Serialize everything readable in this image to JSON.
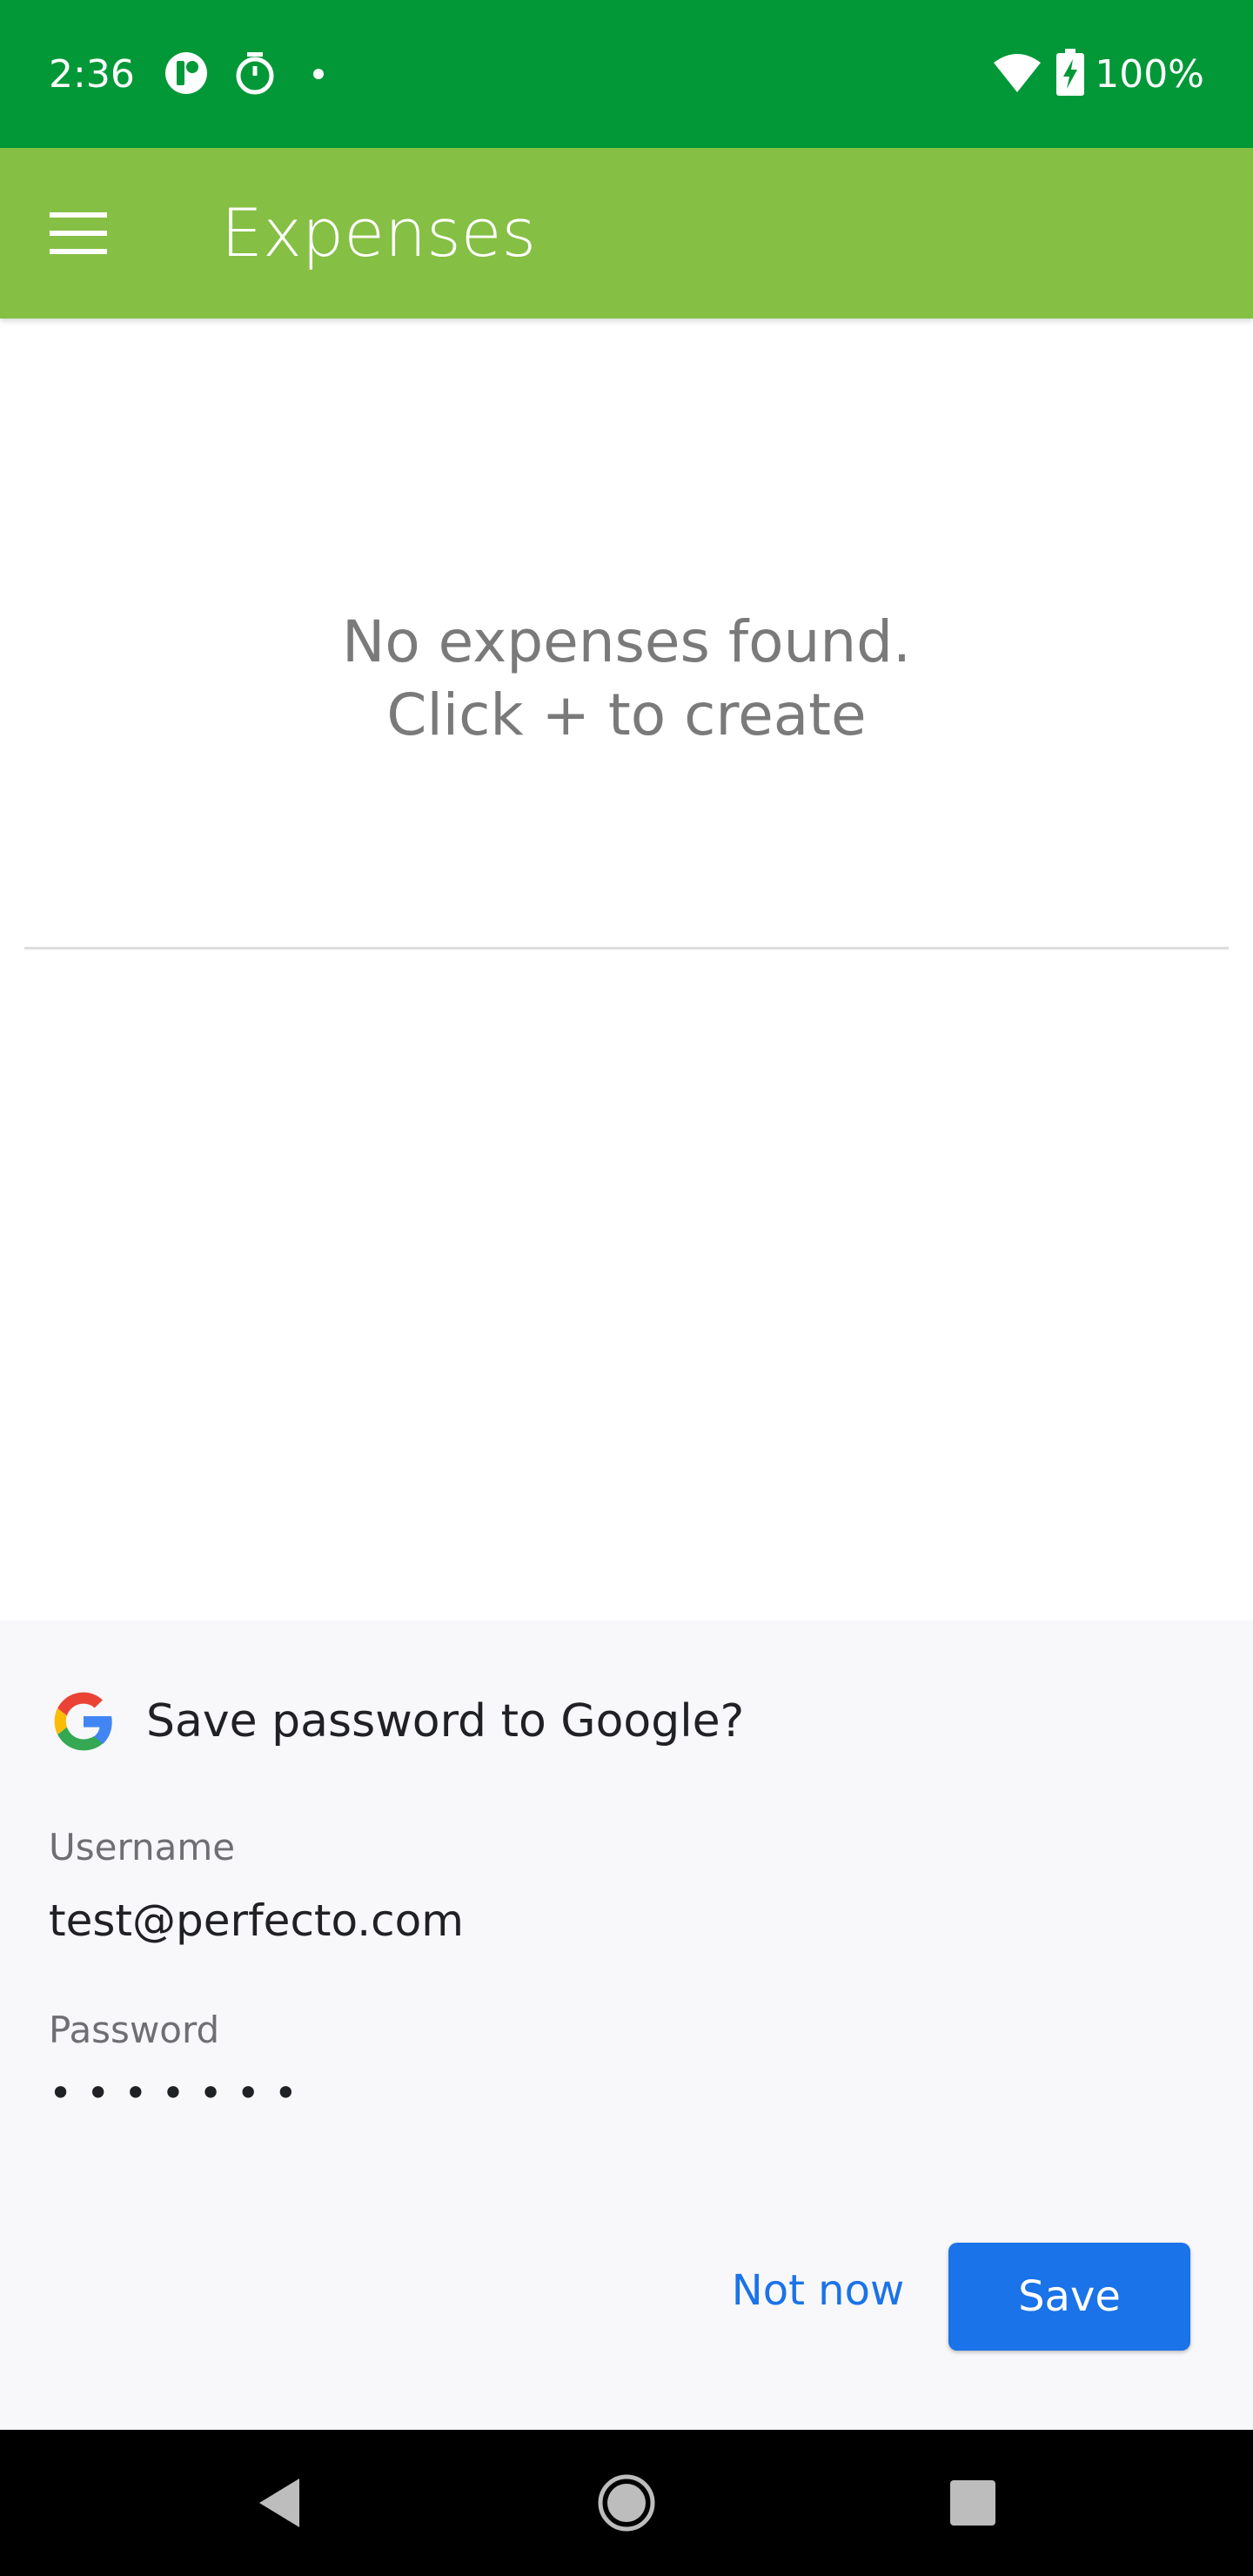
{
  "status_bar": {
    "time": "2:36",
    "battery": "100%",
    "icons": [
      "app-notification-icon",
      "timer-icon",
      "dot-icon",
      "wifi-icon",
      "battery-charging-icon"
    ]
  },
  "app_bar": {
    "title": "Expenses",
    "menu_icon": "hamburger-menu-icon",
    "color": "#85bf44"
  },
  "empty_state": {
    "line1": "No expenses found.",
    "line2": "Click + to create"
  },
  "save_password_sheet": {
    "title": "Save password to Google?",
    "username_label": "Username",
    "username_value": "test@perfecto.com",
    "password_label": "Password",
    "password_value": "•••••••",
    "not_now_label": "Not now",
    "save_label": "Save",
    "accent_color": "#1a73e8"
  },
  "nav_bar": {
    "icons": [
      "back-icon",
      "home-icon",
      "recents-icon"
    ]
  }
}
